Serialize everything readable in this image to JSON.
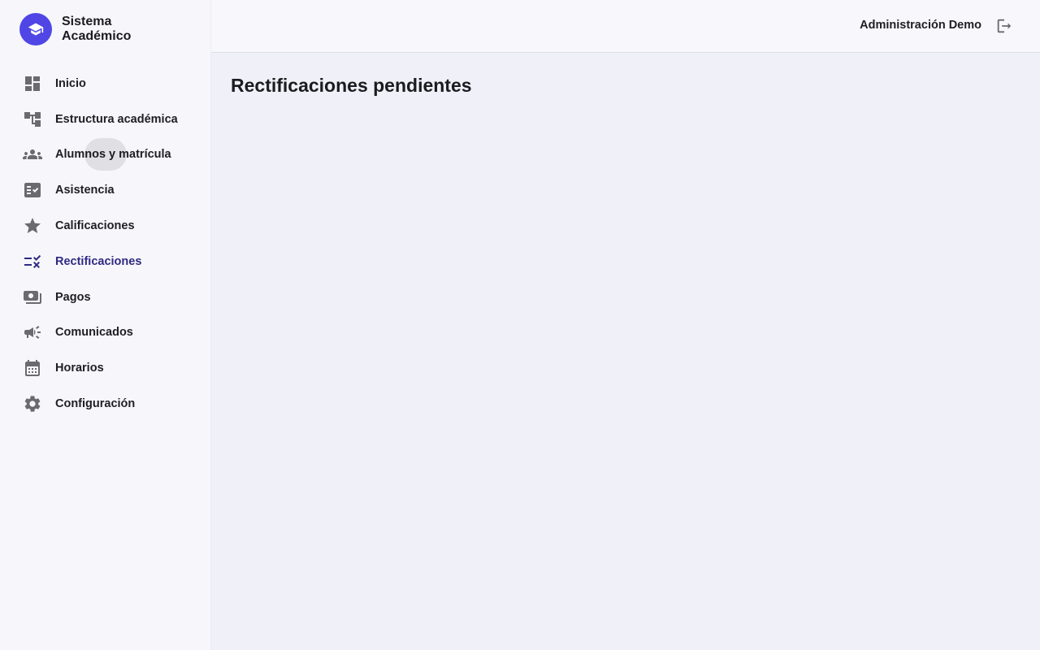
{
  "app": {
    "title": "Sistema Académico",
    "logo_icon": "graduation-cap-icon",
    "accent_color": "#4f46e5",
    "active_color": "#2f2a82"
  },
  "sidebar": {
    "items": [
      {
        "label": "Inicio",
        "icon": "dashboard-icon"
      },
      {
        "label": "Estructura académica",
        "icon": "account-tree-icon"
      },
      {
        "label": "Alumnos y matrícula",
        "icon": "groups-icon"
      },
      {
        "label": "Asistencia",
        "icon": "fact-check-icon"
      },
      {
        "label": "Calificaciones",
        "icon": "star-icon"
      },
      {
        "label": "Rectificaciones",
        "icon": "rule-icon",
        "active": true
      },
      {
        "label": "Pagos",
        "icon": "payments-icon"
      },
      {
        "label": "Comunicados",
        "icon": "campaign-icon"
      },
      {
        "label": "Horarios",
        "icon": "calendar-icon"
      },
      {
        "label": "Configuración",
        "icon": "gear-icon"
      }
    ]
  },
  "header": {
    "user_name": "Administración Demo",
    "logout_icon": "logout-icon"
  },
  "main": {
    "page_title": "Rectificaciones pendientes"
  }
}
